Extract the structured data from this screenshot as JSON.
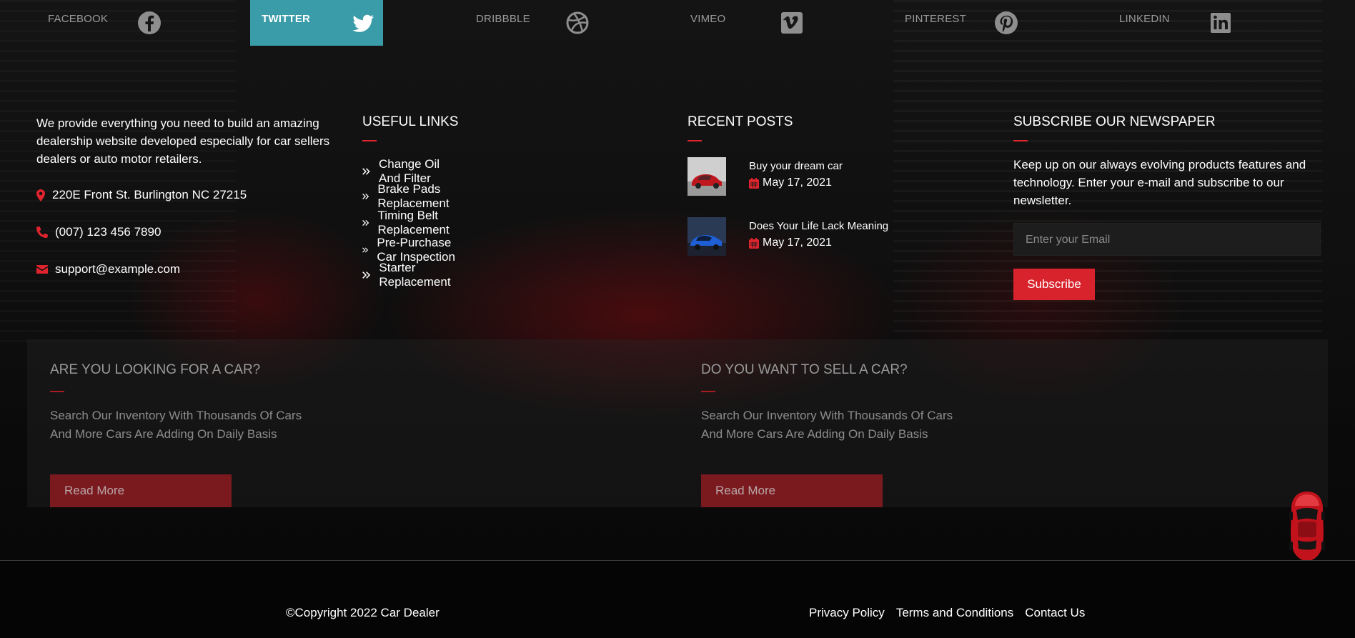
{
  "social": [
    {
      "label": "FACEBOOK",
      "icon": "facebook-icon"
    },
    {
      "label": "TWITTER",
      "icon": "twitter-icon",
      "active": true
    },
    {
      "label": "DRIBBBLE",
      "icon": "dribbble-icon"
    },
    {
      "label": "VIMEO",
      "icon": "vimeo-icon"
    },
    {
      "label": "PINTEREST",
      "icon": "pinterest-icon"
    },
    {
      "label": "LINKEDIN",
      "icon": "linkedin-icon"
    }
  ],
  "about": {
    "text": "We provide everything you need to build an amazing dealership website developed especially for car sellers dealers or auto motor retailers.",
    "address": "220E Front St. Burlington NC 27215",
    "phone": "(007) 123 456 7890",
    "email": "support@example.com"
  },
  "useful_links": {
    "title": "USEFUL LINKS",
    "items": [
      "Change Oil And Filter",
      "Brake Pads Replacement",
      "Timing Belt Replacement",
      "Pre-Purchase Car Inspection",
      "Starter Replacement"
    ]
  },
  "recent_posts": {
    "title": "RECENT POSTS",
    "items": [
      {
        "title": "Buy your dream car",
        "date": "May 17, 2021"
      },
      {
        "title": "Does Your Life Lack Meaning",
        "date": "May 17, 2021"
      }
    ]
  },
  "newsletter": {
    "title": "SUBSCRIBE OUR NEWSPAPER",
    "text": "Keep up on our always evolving products features and technology. Enter your e-mail and subscribe to our newsletter.",
    "placeholder": "Enter your Email",
    "button": "Subscribe"
  },
  "cta": [
    {
      "title": "ARE YOU LOOKING FOR A CAR?",
      "line1": "Search Our Inventory With Thousands Of Cars",
      "line2": "And More Cars Are Adding On Daily Basis",
      "button": "Read More"
    },
    {
      "title": "DO YOU WANT TO SELL A CAR?",
      "line1": "Search Our Inventory With Thousands Of Cars",
      "line2": "And More Cars Are Adding On Daily Basis",
      "button": "Read More"
    }
  ],
  "footer": {
    "copyright": "©Copyright 2022 Car Dealer",
    "links": [
      "Privacy Policy",
      "Terms and Conditions",
      "Contact Us"
    ]
  },
  "colors": {
    "accent": "#d8232c",
    "twitter_active": "#3a9ca8"
  }
}
